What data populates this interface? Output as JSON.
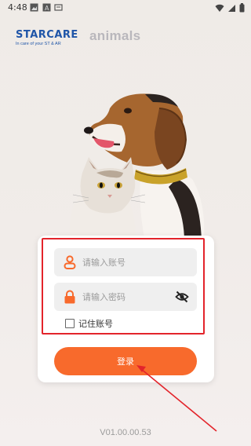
{
  "status_bar": {
    "time": "4:48"
  },
  "branding": {
    "starcare_name": "STARCARE",
    "starcare_tagline": "In care of your ST & AR",
    "animals_name": "animals"
  },
  "login": {
    "account_placeholder": "请输入账号",
    "password_placeholder": "请输入密码",
    "remember_label": "记住账号",
    "submit_label": "登录"
  },
  "version": "V01.00.00.53",
  "colors": {
    "accent": "#f86a2c",
    "brand_blue": "#1f55a8",
    "annotation_red": "#e3242b"
  },
  "icons": {
    "user": "user-icon",
    "lock": "lock-icon",
    "password_visibility": "eye-off-icon"
  }
}
